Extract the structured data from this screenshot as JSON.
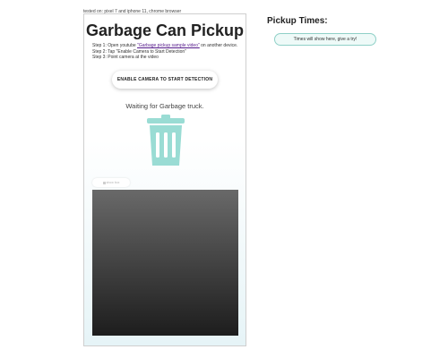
{
  "tested_note": "tested on: pixel 7 and iphone 11, chrome browser",
  "card": {
    "title": "Garbage Can Pickup",
    "steps": {
      "step1_prefix": "Step 1: Open youtube ",
      "step1_link": "\"Garbage pickup sample video\"",
      "step1_suffix": " on another device.",
      "step2": "Step 2: Tap \"Enable Camera to Start Detection\"",
      "step3": "Step 3: Point camera at the video"
    },
    "enable_button_label": "ENABLE CAMERA TO START DETECTION",
    "status_text": "Waiting for Garbage truck.",
    "show_box_label": "show box",
    "icon": "trash-can-icon",
    "colors": {
      "trash_icon": "#9adcd4",
      "pill_border": "#8fd0c7",
      "link": "#551a8b"
    }
  },
  "pickup": {
    "heading": "Pickup Times:",
    "placeholder": "Times will show here, give a try!"
  }
}
